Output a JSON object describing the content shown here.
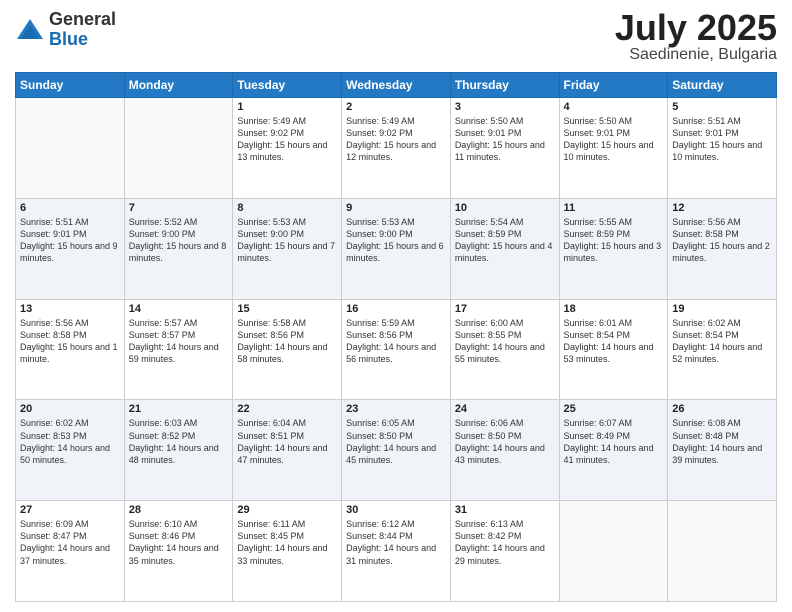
{
  "logo": {
    "general": "General",
    "blue": "Blue"
  },
  "title": "July 2025",
  "subtitle": "Saedinenie, Bulgaria",
  "weekdays": [
    "Sunday",
    "Monday",
    "Tuesday",
    "Wednesday",
    "Thursday",
    "Friday",
    "Saturday"
  ],
  "weeks": [
    [
      {
        "day": "",
        "sunrise": "",
        "sunset": "",
        "daylight": ""
      },
      {
        "day": "",
        "sunrise": "",
        "sunset": "",
        "daylight": ""
      },
      {
        "day": "1",
        "sunrise": "Sunrise: 5:49 AM",
        "sunset": "Sunset: 9:02 PM",
        "daylight": "Daylight: 15 hours and 13 minutes."
      },
      {
        "day": "2",
        "sunrise": "Sunrise: 5:49 AM",
        "sunset": "Sunset: 9:02 PM",
        "daylight": "Daylight: 15 hours and 12 minutes."
      },
      {
        "day": "3",
        "sunrise": "Sunrise: 5:50 AM",
        "sunset": "Sunset: 9:01 PM",
        "daylight": "Daylight: 15 hours and 11 minutes."
      },
      {
        "day": "4",
        "sunrise": "Sunrise: 5:50 AM",
        "sunset": "Sunset: 9:01 PM",
        "daylight": "Daylight: 15 hours and 10 minutes."
      },
      {
        "day": "5",
        "sunrise": "Sunrise: 5:51 AM",
        "sunset": "Sunset: 9:01 PM",
        "daylight": "Daylight: 15 hours and 10 minutes."
      }
    ],
    [
      {
        "day": "6",
        "sunrise": "Sunrise: 5:51 AM",
        "sunset": "Sunset: 9:01 PM",
        "daylight": "Daylight: 15 hours and 9 minutes."
      },
      {
        "day": "7",
        "sunrise": "Sunrise: 5:52 AM",
        "sunset": "Sunset: 9:00 PM",
        "daylight": "Daylight: 15 hours and 8 minutes."
      },
      {
        "day": "8",
        "sunrise": "Sunrise: 5:53 AM",
        "sunset": "Sunset: 9:00 PM",
        "daylight": "Daylight: 15 hours and 7 minutes."
      },
      {
        "day": "9",
        "sunrise": "Sunrise: 5:53 AM",
        "sunset": "Sunset: 9:00 PM",
        "daylight": "Daylight: 15 hours and 6 minutes."
      },
      {
        "day": "10",
        "sunrise": "Sunrise: 5:54 AM",
        "sunset": "Sunset: 8:59 PM",
        "daylight": "Daylight: 15 hours and 4 minutes."
      },
      {
        "day": "11",
        "sunrise": "Sunrise: 5:55 AM",
        "sunset": "Sunset: 8:59 PM",
        "daylight": "Daylight: 15 hours and 3 minutes."
      },
      {
        "day": "12",
        "sunrise": "Sunrise: 5:56 AM",
        "sunset": "Sunset: 8:58 PM",
        "daylight": "Daylight: 15 hours and 2 minutes."
      }
    ],
    [
      {
        "day": "13",
        "sunrise": "Sunrise: 5:56 AM",
        "sunset": "Sunset: 8:58 PM",
        "daylight": "Daylight: 15 hours and 1 minute."
      },
      {
        "day": "14",
        "sunrise": "Sunrise: 5:57 AM",
        "sunset": "Sunset: 8:57 PM",
        "daylight": "Daylight: 14 hours and 59 minutes."
      },
      {
        "day": "15",
        "sunrise": "Sunrise: 5:58 AM",
        "sunset": "Sunset: 8:56 PM",
        "daylight": "Daylight: 14 hours and 58 minutes."
      },
      {
        "day": "16",
        "sunrise": "Sunrise: 5:59 AM",
        "sunset": "Sunset: 8:56 PM",
        "daylight": "Daylight: 14 hours and 56 minutes."
      },
      {
        "day": "17",
        "sunrise": "Sunrise: 6:00 AM",
        "sunset": "Sunset: 8:55 PM",
        "daylight": "Daylight: 14 hours and 55 minutes."
      },
      {
        "day": "18",
        "sunrise": "Sunrise: 6:01 AM",
        "sunset": "Sunset: 8:54 PM",
        "daylight": "Daylight: 14 hours and 53 minutes."
      },
      {
        "day": "19",
        "sunrise": "Sunrise: 6:02 AM",
        "sunset": "Sunset: 8:54 PM",
        "daylight": "Daylight: 14 hours and 52 minutes."
      }
    ],
    [
      {
        "day": "20",
        "sunrise": "Sunrise: 6:02 AM",
        "sunset": "Sunset: 8:53 PM",
        "daylight": "Daylight: 14 hours and 50 minutes."
      },
      {
        "day": "21",
        "sunrise": "Sunrise: 6:03 AM",
        "sunset": "Sunset: 8:52 PM",
        "daylight": "Daylight: 14 hours and 48 minutes."
      },
      {
        "day": "22",
        "sunrise": "Sunrise: 6:04 AM",
        "sunset": "Sunset: 8:51 PM",
        "daylight": "Daylight: 14 hours and 47 minutes."
      },
      {
        "day": "23",
        "sunrise": "Sunrise: 6:05 AM",
        "sunset": "Sunset: 8:50 PM",
        "daylight": "Daylight: 14 hours and 45 minutes."
      },
      {
        "day": "24",
        "sunrise": "Sunrise: 6:06 AM",
        "sunset": "Sunset: 8:50 PM",
        "daylight": "Daylight: 14 hours and 43 minutes."
      },
      {
        "day": "25",
        "sunrise": "Sunrise: 6:07 AM",
        "sunset": "Sunset: 8:49 PM",
        "daylight": "Daylight: 14 hours and 41 minutes."
      },
      {
        "day": "26",
        "sunrise": "Sunrise: 6:08 AM",
        "sunset": "Sunset: 8:48 PM",
        "daylight": "Daylight: 14 hours and 39 minutes."
      }
    ],
    [
      {
        "day": "27",
        "sunrise": "Sunrise: 6:09 AM",
        "sunset": "Sunset: 8:47 PM",
        "daylight": "Daylight: 14 hours and 37 minutes."
      },
      {
        "day": "28",
        "sunrise": "Sunrise: 6:10 AM",
        "sunset": "Sunset: 8:46 PM",
        "daylight": "Daylight: 14 hours and 35 minutes."
      },
      {
        "day": "29",
        "sunrise": "Sunrise: 6:11 AM",
        "sunset": "Sunset: 8:45 PM",
        "daylight": "Daylight: 14 hours and 33 minutes."
      },
      {
        "day": "30",
        "sunrise": "Sunrise: 6:12 AM",
        "sunset": "Sunset: 8:44 PM",
        "daylight": "Daylight: 14 hours and 31 minutes."
      },
      {
        "day": "31",
        "sunrise": "Sunrise: 6:13 AM",
        "sunset": "Sunset: 8:42 PM",
        "daylight": "Daylight: 14 hours and 29 minutes."
      },
      {
        "day": "",
        "sunrise": "",
        "sunset": "",
        "daylight": ""
      },
      {
        "day": "",
        "sunrise": "",
        "sunset": "",
        "daylight": ""
      }
    ]
  ]
}
